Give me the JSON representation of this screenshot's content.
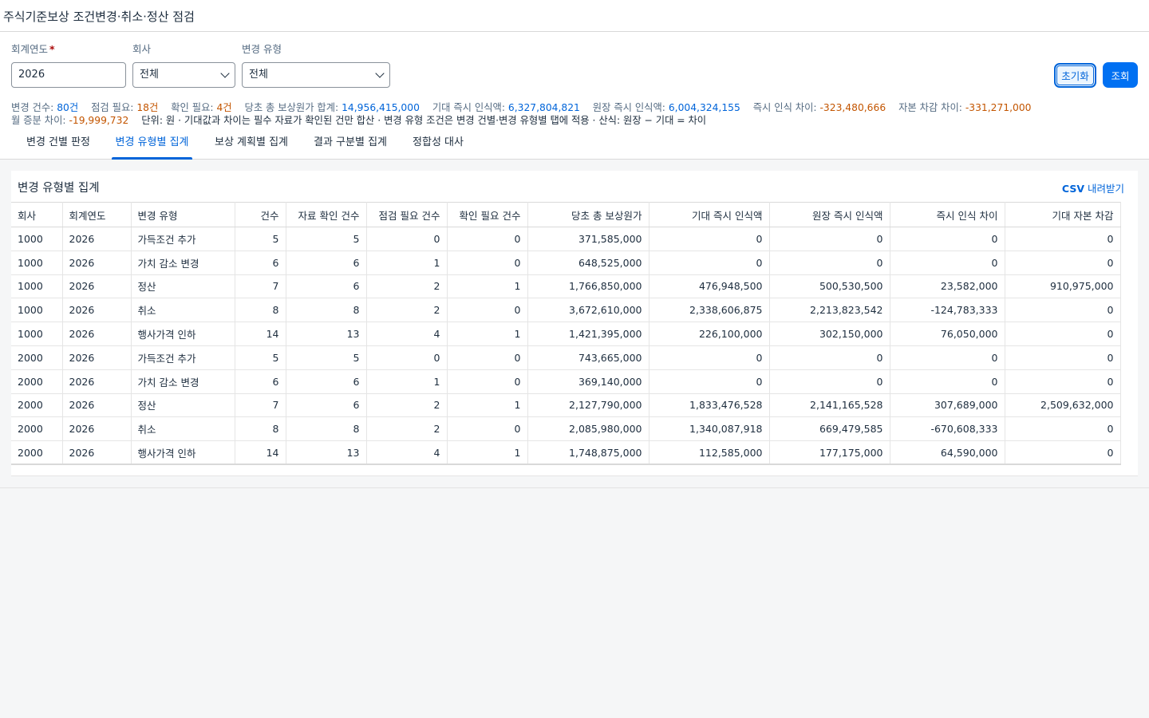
{
  "page": {
    "title": "주식기준보상 조건변경·취소·정산 점검"
  },
  "filters": {
    "year": {
      "label": "회계연도",
      "value": "2026"
    },
    "company": {
      "label": "회사",
      "value": "전체"
    },
    "change_type": {
      "label": "변경 유형",
      "value": "전체"
    },
    "reset_label": "초기화",
    "search_label": "조회"
  },
  "stats": {
    "change_count": {
      "label": "변경 건수: ",
      "value": "80건"
    },
    "review_needed": {
      "label": "점검 필요: ",
      "value": "18건"
    },
    "confirm_needed": {
      "label": "확인 필요: ",
      "value": "4건"
    },
    "original_cost": {
      "label": "당초 총 보상원가 합계: ",
      "value": "14,956,415,000"
    },
    "expected_immediate": {
      "label": "기대 즉시 인식액: ",
      "value": "6,327,804,821"
    },
    "ledger_immediate": {
      "label": "원장 즉시 인식액: ",
      "value": "6,004,324,155"
    },
    "immediate_diff": {
      "label": "즉시 인식 차이: ",
      "value": "-323,480,666"
    },
    "capital_diff": {
      "label": "자본 차감 차이: ",
      "value": "-331,271,000"
    },
    "monthly_diff": {
      "label": "월 증분 차이: ",
      "value": "-19,999,732"
    },
    "note": "단위: 원 · 기대값과 차이는 필수 자료가 확인된 건만 합산 · 변경 유형 조건은 변경 건별·변경 유형별 탭에 적용 · 산식: 원장 − 기대 = 차이"
  },
  "tabs": [
    {
      "label": "변경 건별 판정",
      "active": false
    },
    {
      "label": "변경 유형별 집계",
      "active": true
    },
    {
      "label": "보상 계획별 집계",
      "active": false
    },
    {
      "label": "결과 구분별 집계",
      "active": false
    },
    {
      "label": "정합성 대사",
      "active": false
    }
  ],
  "summary": {
    "title": "변경 유형별 집계",
    "csv_bold": "CSV",
    "csv_rest": " 내려받기",
    "columns": [
      "회사",
      "회계연도",
      "변경 유형",
      "건수",
      "자료 확인 건수",
      "점검 필요 건수",
      "확인 필요 건수",
      "당초 총 보상원가",
      "기대 즉시 인식액",
      "원장 즉시 인식액",
      "즉시 인식 차이",
      "기대 자본 차감"
    ],
    "rows": [
      [
        "1000",
        "2026",
        "가득조건 추가",
        "5",
        "5",
        "0",
        "0",
        "371,585,000",
        "0",
        "0",
        "0",
        "0"
      ],
      [
        "1000",
        "2026",
        "가치 감소 변경",
        "6",
        "6",
        "1",
        "0",
        "648,525,000",
        "0",
        "0",
        "0",
        "0"
      ],
      [
        "1000",
        "2026",
        "정산",
        "7",
        "6",
        "2",
        "1",
        "1,766,850,000",
        "476,948,500",
        "500,530,500",
        "23,582,000",
        "910,975,000"
      ],
      [
        "1000",
        "2026",
        "취소",
        "8",
        "8",
        "2",
        "0",
        "3,672,610,000",
        "2,338,606,875",
        "2,213,823,542",
        "-124,783,333",
        "0"
      ],
      [
        "1000",
        "2026",
        "행사가격 인하",
        "14",
        "13",
        "4",
        "1",
        "1,421,395,000",
        "226,100,000",
        "302,150,000",
        "76,050,000",
        "0"
      ],
      [
        "2000",
        "2026",
        "가득조건 추가",
        "5",
        "5",
        "0",
        "0",
        "743,665,000",
        "0",
        "0",
        "0",
        "0"
      ],
      [
        "2000",
        "2026",
        "가치 감소 변경",
        "6",
        "6",
        "1",
        "0",
        "369,140,000",
        "0",
        "0",
        "0",
        "0"
      ],
      [
        "2000",
        "2026",
        "정산",
        "7",
        "6",
        "2",
        "1",
        "2,127,790,000",
        "1,833,476,528",
        "2,141,165,528",
        "307,689,000",
        "2,509,632,000"
      ],
      [
        "2000",
        "2026",
        "취소",
        "8",
        "8",
        "2",
        "0",
        "2,085,980,000",
        "1,340,087,918",
        "669,479,585",
        "-670,608,333",
        "0"
      ],
      [
        "2000",
        "2026",
        "행사가격 인하",
        "14",
        "13",
        "4",
        "1",
        "1,748,875,000",
        "112,585,000",
        "177,175,000",
        "64,590,000",
        "0"
      ]
    ]
  }
}
